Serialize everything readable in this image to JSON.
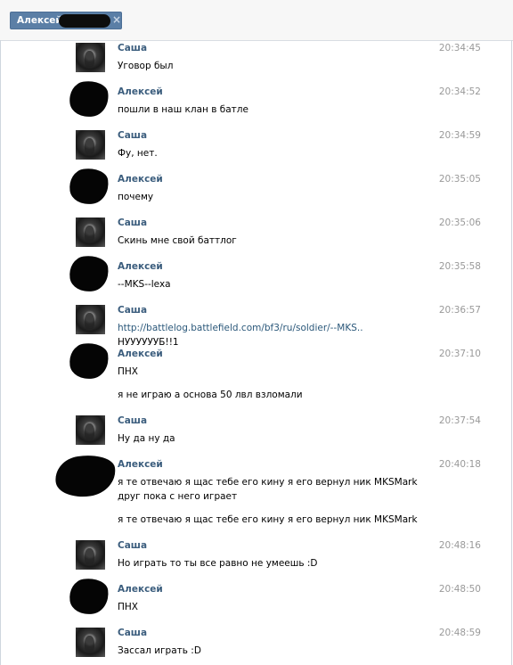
{
  "tab": {
    "title": "Алексей",
    "close": "×"
  },
  "messages": [
    {
      "author": "Саша",
      "time": "20:34:45",
      "text": "Уговор был"
    },
    {
      "author": "Алексей",
      "time": "20:34:52",
      "text": "пошли в наш клан в батле"
    },
    {
      "author": "Саша",
      "time": "20:34:59",
      "text": "Фу, нет."
    },
    {
      "author": "Алексей",
      "time": "20:35:05",
      "text": "почему"
    },
    {
      "author": "Саша",
      "time": "20:35:06",
      "text": "Скинь мне свой баттлог"
    },
    {
      "author": "Алексей",
      "time": "20:35:58",
      "text": "--MKS--lexa"
    },
    {
      "author": "Саша",
      "time": "20:36:57",
      "link": "http://battlelog.battlefield.com/bf3/ru/soldier/--MKS..",
      "text_after": " НУУУУУУБ!!1"
    },
    {
      "author": "Алексей",
      "time": "20:37:10",
      "text": "ПНХ",
      "text2": "я не играю а основа 50 лвл взломали"
    },
    {
      "author": "Саша",
      "time": "20:37:54",
      "text": "Ну да ну да"
    },
    {
      "author": "Алексей",
      "time": "20:40:18",
      "text": "я те отвечаю я щас тебе его кину я его вернул ник MKSMark друг пока с него играет",
      "text2": "я те отвечаю я щас тебе его кину я его вернул ник MKSMark"
    },
    {
      "author": "Саша",
      "time": "20:48:16",
      "text": "Но играть то ты все равно не умеешь :D"
    },
    {
      "author": "Алексей",
      "time": "20:48:50",
      "text": "ПНХ"
    },
    {
      "author": "Саша",
      "time": "20:48:59",
      "text": "Зассал играть :D"
    }
  ]
}
